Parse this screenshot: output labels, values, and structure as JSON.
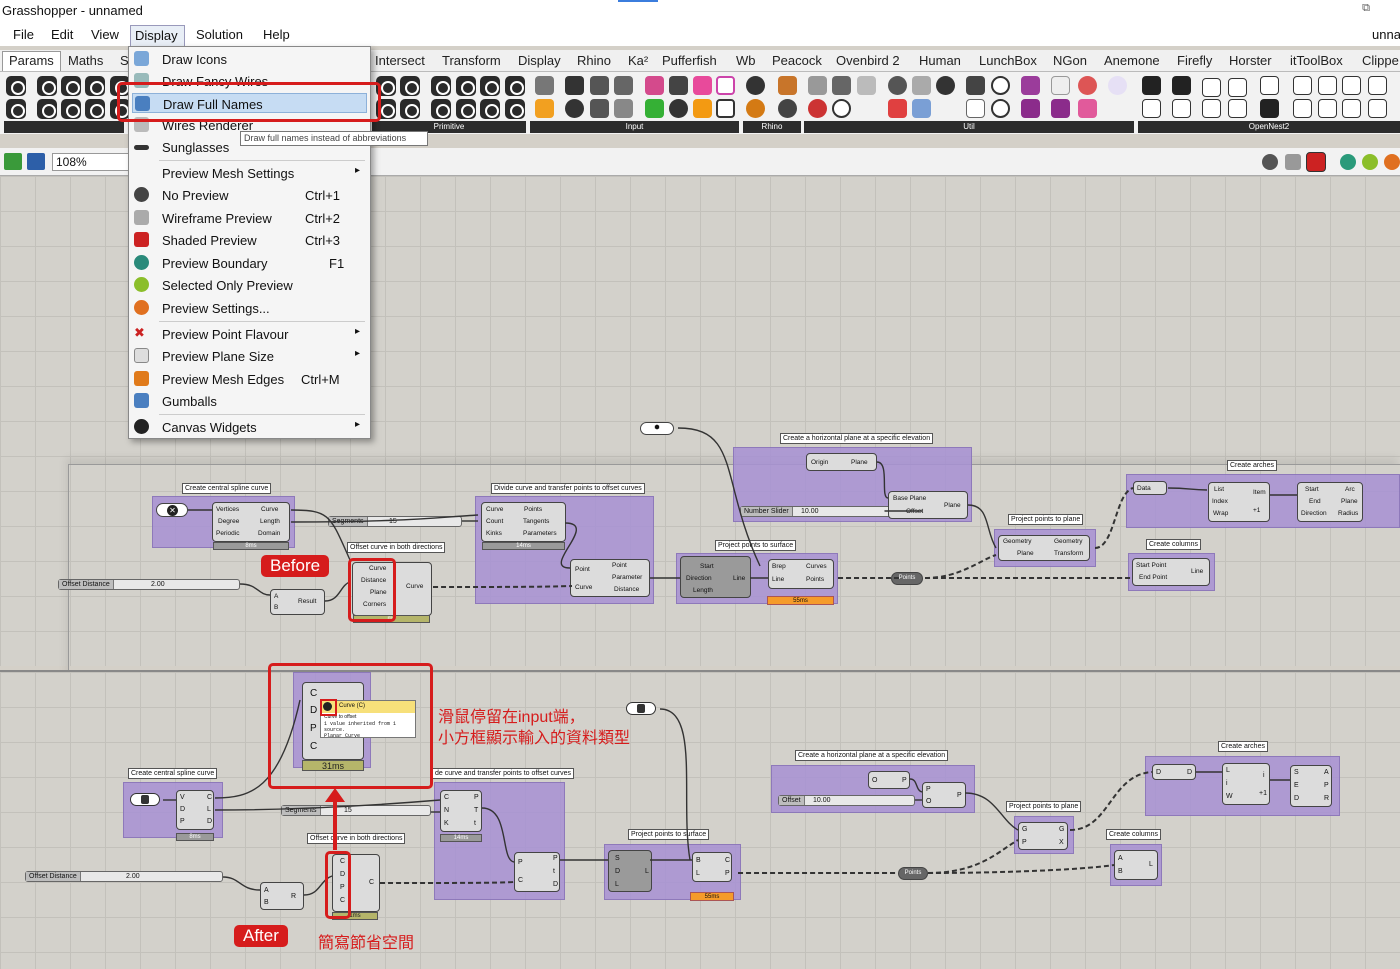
{
  "window": {
    "title": "Grasshopper - unnamed",
    "title_right": "unna",
    "restore_glyph": "⧉"
  },
  "menubar": {
    "file": "File",
    "edit": "Edit",
    "view": "View",
    "display": "Display",
    "solution": "Solution",
    "help": "Help"
  },
  "tabs": {
    "params": "Params",
    "maths": "Maths",
    "s": "S",
    "intersect": "Intersect",
    "transform": "Transform",
    "display": "Display",
    "rhino": "Rhino",
    "ka": "Ka²",
    "pufferfish": "Pufferfish",
    "wb": "Wb",
    "peacock": "Peacock",
    "ovenbird": "Ovenbird 2",
    "human": "Human",
    "lunchbox": "LunchBox",
    "ngon": "NGon",
    "anemone": "Anemone",
    "firefly": "Firefly",
    "horster": "Horster",
    "ittoolbox": "itToolBox",
    "clipper": "Clippe"
  },
  "ribbon": {
    "primitive": "Primitive",
    "input": "Input",
    "rhino": "Rhino",
    "util": "Util",
    "opennest": "OpenNest2"
  },
  "canvas": {
    "zoom": "108%"
  },
  "dropdown": {
    "draw_icons": "Draw Icons",
    "draw_fancy_wires": "Draw Fancy Wires",
    "draw_full_names": "Draw Full Names",
    "wires_renderer": "Wires Renderer",
    "sunglasses": "Sunglasses",
    "preview_mesh_settings": "Preview Mesh Settings",
    "no_preview": "No Preview",
    "no_preview_sc": "Ctrl+1",
    "wireframe_preview": "Wireframe Preview",
    "wireframe_preview_sc": "Ctrl+2",
    "shaded_preview": "Shaded Preview",
    "shaded_preview_sc": "Ctrl+3",
    "preview_boundary": "Preview Boundary",
    "preview_boundary_sc": "F1",
    "selected_only": "Selected Only Preview",
    "preview_settings": "Preview Settings...",
    "point_flavour": "Preview Point Flavour",
    "plane_size": "Preview Plane Size",
    "mesh_edges": "Preview Mesh Edges",
    "mesh_edges_sc": "Ctrl+M",
    "gumballs": "Gumballs",
    "canvas_widgets": "Canvas Widgets",
    "tooltip": "Draw full names instead of abbreviations",
    "submenu_arrow": "▸"
  },
  "before": {
    "badge": "Before",
    "g_spline": "Create central spline curve",
    "g_divide": "Divide curve and transfer points to offset curves",
    "g_offset": "Offset curve in both directions",
    "g_project_surface": "Project   points to surface",
    "g_hplane": "Create a horizontal plane at a specific elevation",
    "g_project_plane": "Project points to plane",
    "g_arches": "Create arches",
    "g_columns": "Create columns",
    "vertices": "Vertices",
    "degree": "Degree",
    "periodic": "Periodic",
    "curve_out": "Curve",
    "length": "Length",
    "domain": "Domain",
    "t_8ms": "8ms",
    "segments": "Segments",
    "segments_val": "15",
    "offset_dist": "Offset Distance",
    "offset_val": "2.00",
    "result": "Result",
    "a": "A",
    "b": "B",
    "curve": "Curve",
    "distance": "Distance",
    "plane": "Plane",
    "corners": "Corners",
    "curve_o": "Curve",
    "t_ms": "ms",
    "count": "Count",
    "kinks": "Kinks",
    "points": "Points",
    "tangents": "Tangents",
    "parameters": "Parameters",
    "t_14ms": "14ms",
    "point": "Point",
    "parameter": "Parameter",
    "start": "Start",
    "direction": "Direction",
    "line": "Line",
    "brep": "Brep",
    "curves": "Curves",
    "t_55ms": "55ms",
    "origin": "Origin",
    "plane_o": "Plane",
    "base_plane": "Base Plane",
    "offset": "Offset",
    "number_slider": "Number Slider",
    "num_val": "10.00",
    "geometry": "Geometry",
    "transform": "Transform",
    "points_cap": "Points",
    "data": "Data",
    "list": "List",
    "index": "Index",
    "wrap": "Wrap",
    "item": "Item",
    "plus1": "+1",
    "end": "End",
    "arc": "Arc",
    "radius": "Radius",
    "start_point": "Start Point",
    "end_point": "End Point"
  },
  "after": {
    "badge": "After",
    "note1": "滑鼠停留在input端，",
    "note1b": "小方框顯示輸入的資料類型",
    "note2": "簡寫節省空間",
    "tip_title": "Curve (C)",
    "tip_sub": "Curve to offset",
    "tip_body1": "1 value inherited from 1 source.",
    "tip_body2": "Planar Curve",
    "t_31ms": "31ms",
    "g_spline": "Create central spline curve",
    "g_divide": "de curve and transfer points to offset curves",
    "g_offset": "Offset curve in both directions",
    "g_project_surface": "Project   points to surface",
    "g_hplane": "Create a horizontal plane at a specific elevation",
    "g_project_plane": "Project points to plane",
    "g_arches": "Create arches",
    "g_columns": "Create columns",
    "segments": "Segments",
    "segments_val": "15",
    "offset_dist": "Offset Distance",
    "offset_val": "2.00",
    "offset": "Offset",
    "num_val": "10.00",
    "points_cap": "Points",
    "t_8ms": "8ms",
    "t_14ms": "14ms",
    "t_55ms": "55ms",
    "t_1ms": "1ms",
    "C": "C",
    "D": "D",
    "P": "P",
    "V": "V",
    "L": "L",
    "A": "A",
    "B": "B",
    "R": "R",
    "N": "N",
    "K": "K",
    "T": "T",
    "t": "t",
    "S": "S",
    "O": "O",
    "X": "X",
    "G": "G",
    "I": "I",
    "W": "W",
    "E": "E",
    "i": "i",
    "plus1": "+1"
  },
  "colors": {
    "accent_red": "#d61c1c",
    "group_purple": "#a791d4",
    "highlight_blue": "#c6dcf3",
    "timer_orange": "#f59b2a"
  },
  "icons": [
    "close-icon",
    "save-icon",
    "open-icon",
    "preview-icon",
    "checkmark-icon",
    "arc-icon",
    "line-icon",
    "plane-icon"
  ]
}
